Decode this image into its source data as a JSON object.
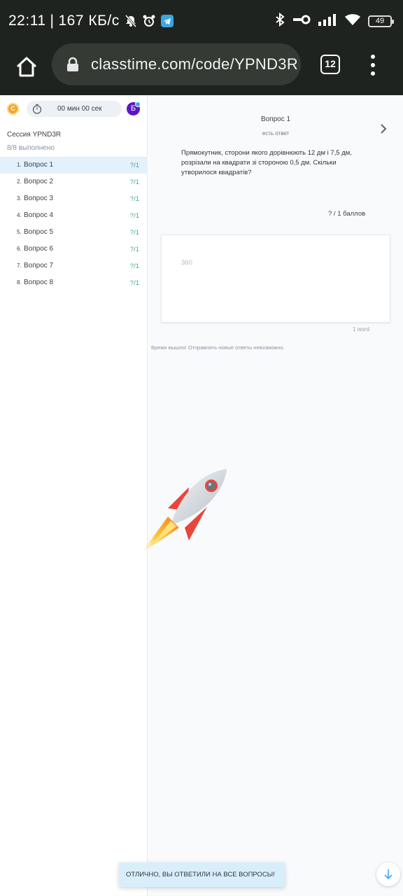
{
  "status_bar": {
    "time": "22:11",
    "separator": "|",
    "speed": "167 КБ/с",
    "battery": "49"
  },
  "browser": {
    "url": "classtime.com/code/YPND3R",
    "tab_count": "12"
  },
  "sidebar": {
    "coin_label": "C",
    "timer": "00 мин 00 сек",
    "avatar_letter": "Б",
    "session_title": "Сессия YPND3R",
    "progress": "8/8 выполнено",
    "questions": [
      {
        "num": "1.",
        "label": "Вопрос 1",
        "score": "?/1",
        "active": true
      },
      {
        "num": "2.",
        "label": "Вопрос 2",
        "score": "?/1",
        "active": false
      },
      {
        "num": "3.",
        "label": "Вопрос 3",
        "score": "?/1",
        "active": false
      },
      {
        "num": "4.",
        "label": "Вопрос 4",
        "score": "?/1",
        "active": false
      },
      {
        "num": "5.",
        "label": "Вопрос 5",
        "score": "?/1",
        "active": false
      },
      {
        "num": "6.",
        "label": "Вопрос 6",
        "score": "?/1",
        "active": false
      },
      {
        "num": "7.",
        "label": "Вопрос 7",
        "score": "?/1",
        "active": false
      },
      {
        "num": "8.",
        "label": "Вопрос 8",
        "score": "?/1",
        "active": false
      }
    ]
  },
  "main": {
    "question_title": "Вопрос 1",
    "question_status": "есть ответ",
    "question_text": "Прямокутник, сторони якого дорівнюють 12 дм і 7,5 дм, розрізали на квадрати зі стороною 0,5 дм. Скільки утворилося квадратів?",
    "points": "?  /  1  баллов",
    "answer_value": "360",
    "word_count": "1 word",
    "time_message": "Время вышло! Отправлять новые ответы невозможно."
  },
  "toast": {
    "text": "ОТЛИЧНО, ВЫ ОТВЕТИЛИ НА ВСЕ ВОПРОСЫ!"
  },
  "colors": {
    "accent": "#46a7a0",
    "active_row": "#e2f1fb",
    "avatar": "#5b16c7",
    "coin": "#f5a623"
  }
}
